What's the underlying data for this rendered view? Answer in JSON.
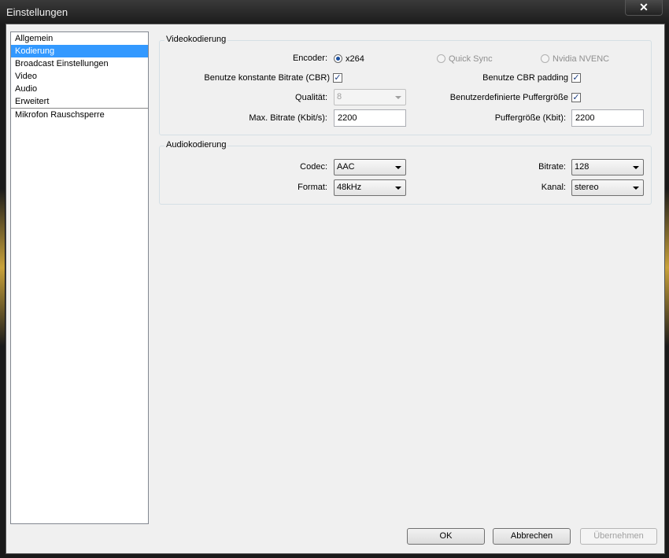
{
  "window": {
    "title": "Einstellungen",
    "close_glyph": "✕"
  },
  "sidebar": {
    "items": [
      {
        "label": "Allgemein"
      },
      {
        "label": "Kodierung"
      },
      {
        "label": "Broadcast Einstellungen"
      },
      {
        "label": "Video"
      },
      {
        "label": "Audio"
      },
      {
        "label": "Erweitert"
      },
      {
        "label": "Mikrofon Rauschsperre"
      }
    ],
    "selected": "Kodierung"
  },
  "video": {
    "group_title": "Videokodierung",
    "encoder_label": "Encoder:",
    "encoder_options": [
      {
        "label": "x264",
        "checked": true,
        "enabled": true
      },
      {
        "label": "Quick Sync",
        "checked": false,
        "enabled": false
      },
      {
        "label": "Nvidia NVENC",
        "checked": false,
        "enabled": false
      }
    ],
    "cbr_label": "Benutze konstante Bitrate (CBR)",
    "cbr_checked": true,
    "cbr_padding_label": "Benutze CBR padding",
    "cbr_padding_checked": true,
    "quality_label": "Qualität:",
    "quality_value": "8",
    "custom_buffer_label": "Benutzerdefinierte Puffergröße",
    "custom_buffer_checked": true,
    "max_bitrate_label": "Max. Bitrate (Kbit/s):",
    "max_bitrate_value": "2200",
    "buffer_size_label": "Puffergröße (Kbit):",
    "buffer_size_value": "2200"
  },
  "audio": {
    "group_title": "Audiokodierung",
    "codec_label": "Codec:",
    "codec_value": "AAC",
    "bitrate_label": "Bitrate:",
    "bitrate_value": "128",
    "format_label": "Format:",
    "format_value": "48kHz",
    "channel_label": "Kanal:",
    "channel_value": "stereo"
  },
  "buttons": {
    "ok": "OK",
    "cancel": "Abbrechen",
    "apply": "Übernehmen"
  },
  "glyphs": {
    "check": "✓"
  },
  "colors": {
    "selection": "#3399ff",
    "titlebar": "#2a2a2a",
    "dialog_bg": "#f0f0f0"
  }
}
